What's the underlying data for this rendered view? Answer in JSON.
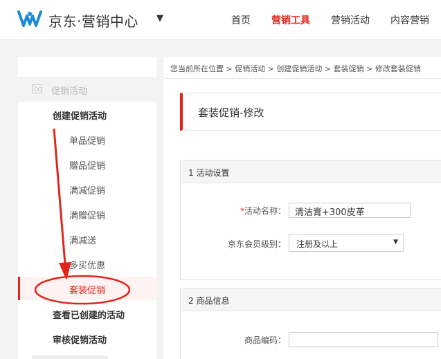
{
  "header": {
    "brand": "京东·营销中心",
    "brand_caret": "▼",
    "nav": [
      {
        "label": "首页"
      },
      {
        "label": "营销工具"
      },
      {
        "label": "营销活动"
      },
      {
        "label": "内容营销"
      }
    ]
  },
  "sidebar": {
    "category": "促销活动",
    "groups": [
      {
        "label": "创建促销活动"
      },
      {
        "label": "查看已创建的活动"
      },
      {
        "label": "审核促销活动"
      }
    ],
    "items": [
      {
        "label": "单品促销"
      },
      {
        "label": "赠品促销"
      },
      {
        "label": "满减促销"
      },
      {
        "label": "满赠促销"
      },
      {
        "label": "满减送"
      },
      {
        "label": "多买优惠"
      },
      {
        "label": "套装促销"
      }
    ]
  },
  "main": {
    "breadcrumb": "您当前所在位置 > 促销活动 > 创建促销活动 > 套装促销 > 修改套装促销",
    "page_title": "套装促销-修改",
    "section1": {
      "title": "1 活动设置",
      "name_required_mark": "*",
      "name_label": "活动名称：",
      "name_value": "清洁膏+300皮革",
      "member_label": "京东会员级别：",
      "member_value": "注册及以上"
    },
    "section2": {
      "title": "2 商品信息",
      "code_label": "商品编码：",
      "code_value": ""
    }
  },
  "colors": {
    "accent": "#e1251b",
    "logo": "#1a8bd6"
  }
}
